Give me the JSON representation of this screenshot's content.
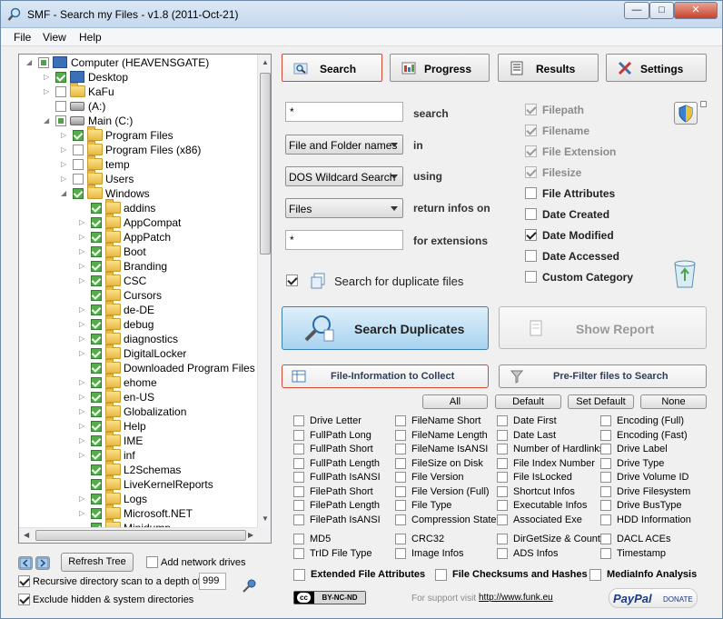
{
  "window": {
    "title": "SMF - Search my Files - v1.8 (2011-Oct-21)"
  },
  "menu": [
    "File",
    "View",
    "Help"
  ],
  "tree": {
    "rows": [
      {
        "label": "Computer (HEAVENSGATE)",
        "level": 0,
        "state": "part",
        "icon": "computer-icon",
        "arrow": "open"
      },
      {
        "label": "Desktop",
        "level": 1,
        "state": "on",
        "icon": "desktop-icon",
        "arrow": "closed"
      },
      {
        "label": "KaFu",
        "level": 1,
        "state": "off",
        "icon": "folder-icon",
        "arrow": "closed"
      },
      {
        "label": "(A:)",
        "level": 1,
        "state": "off",
        "icon": "floppy-drive-icon",
        "arrow": "none"
      },
      {
        "label": "Main (C:)",
        "level": 1,
        "state": "part",
        "icon": "drive-icon",
        "arrow": "open"
      },
      {
        "label": "Program Files",
        "level": 2,
        "state": "on",
        "icon": "folder-icon",
        "arrow": "closed"
      },
      {
        "label": "Program Files (x86)",
        "level": 2,
        "state": "off",
        "icon": "folder-icon",
        "arrow": "closed"
      },
      {
        "label": "temp",
        "level": 2,
        "state": "off",
        "icon": "folder-icon",
        "arrow": "closed"
      },
      {
        "label": "Users",
        "level": 2,
        "state": "off",
        "icon": "folder-icon",
        "arrow": "closed"
      },
      {
        "label": "Windows",
        "level": 2,
        "state": "on",
        "icon": "folder-icon",
        "arrow": "open"
      },
      {
        "label": "addins",
        "level": 3,
        "state": "on",
        "icon": "folder-icon",
        "arrow": "none"
      },
      {
        "label": "AppCompat",
        "level": 3,
        "state": "on",
        "icon": "folder-icon",
        "arrow": "closed"
      },
      {
        "label": "AppPatch",
        "level": 3,
        "state": "on",
        "icon": "folder-icon",
        "arrow": "closed"
      },
      {
        "label": "Boot",
        "level": 3,
        "state": "on",
        "icon": "folder-icon",
        "arrow": "closed"
      },
      {
        "label": "Branding",
        "level": 3,
        "state": "on",
        "icon": "folder-icon",
        "arrow": "closed"
      },
      {
        "label": "CSC",
        "level": 3,
        "state": "on",
        "icon": "folder-icon",
        "arrow": "closed"
      },
      {
        "label": "Cursors",
        "level": 3,
        "state": "on",
        "icon": "folder-icon",
        "arrow": "none"
      },
      {
        "label": "de-DE",
        "level": 3,
        "state": "on",
        "icon": "folder-icon",
        "arrow": "closed"
      },
      {
        "label": "debug",
        "level": 3,
        "state": "on",
        "icon": "folder-icon",
        "arrow": "closed"
      },
      {
        "label": "diagnostics",
        "level": 3,
        "state": "on",
        "icon": "folder-icon",
        "arrow": "closed"
      },
      {
        "label": "DigitalLocker",
        "level": 3,
        "state": "on",
        "icon": "folder-icon",
        "arrow": "closed"
      },
      {
        "label": "Downloaded Program Files",
        "level": 3,
        "state": "on",
        "icon": "folder-icon",
        "arrow": "none"
      },
      {
        "label": "ehome",
        "level": 3,
        "state": "on",
        "icon": "folder-icon",
        "arrow": "closed"
      },
      {
        "label": "en-US",
        "level": 3,
        "state": "on",
        "icon": "folder-icon",
        "arrow": "closed"
      },
      {
        "label": "Globalization",
        "level": 3,
        "state": "on",
        "icon": "folder-icon",
        "arrow": "closed"
      },
      {
        "label": "Help",
        "level": 3,
        "state": "on",
        "icon": "folder-icon",
        "arrow": "closed"
      },
      {
        "label": "IME",
        "level": 3,
        "state": "on",
        "icon": "folder-icon",
        "arrow": "closed"
      },
      {
        "label": "inf",
        "level": 3,
        "state": "on",
        "icon": "folder-icon",
        "arrow": "closed"
      },
      {
        "label": "L2Schemas",
        "level": 3,
        "state": "on",
        "icon": "folder-icon",
        "arrow": "none"
      },
      {
        "label": "LiveKernelReports",
        "level": 3,
        "state": "on",
        "icon": "folder-icon",
        "arrow": "none"
      },
      {
        "label": "Logs",
        "level": 3,
        "state": "on",
        "icon": "folder-icon",
        "arrow": "closed"
      },
      {
        "label": "Microsoft.NET",
        "level": 3,
        "state": "on",
        "icon": "folder-icon",
        "arrow": "closed"
      },
      {
        "label": "Minidump",
        "level": 3,
        "state": "on",
        "icon": "folder-icon",
        "arrow": "none"
      }
    ]
  },
  "bottom_left": {
    "refresh_label": "Refresh Tree",
    "add_network_label": "Add network drives",
    "recursive_label": "Recursive directory scan to a depth of",
    "depth_value": "999",
    "exclude_label": "Exclude hidden & system directories"
  },
  "tabs": [
    {
      "label": "Search",
      "icon": "search-icon",
      "active": true
    },
    {
      "label": "Progress",
      "icon": "progress-icon",
      "active": false
    },
    {
      "label": "Results",
      "icon": "results-icon",
      "active": false
    },
    {
      "label": "Settings",
      "icon": "settings-icon",
      "active": false
    }
  ],
  "search": {
    "pattern": "*",
    "pattern_label": "search",
    "in_value": "File and Folder names",
    "in_label": "in",
    "using_value": "DOS Wildcard Search",
    "using_label": "using",
    "return_value": "Files",
    "return_label": "return infos on",
    "ext_value": "*",
    "ext_label": "for extensions",
    "dup_label": "Search for duplicate files"
  },
  "attributes": [
    {
      "label": "Filepath",
      "checked": true,
      "disabled": true
    },
    {
      "label": "Filename",
      "checked": true,
      "disabled": true
    },
    {
      "label": "File Extension",
      "checked": true,
      "disabled": true
    },
    {
      "label": "Filesize",
      "checked": true,
      "disabled": true
    },
    {
      "label": "File Attributes",
      "checked": false,
      "disabled": false
    },
    {
      "label": "Date Created",
      "checked": false,
      "disabled": false
    },
    {
      "label": "Date Modified",
      "checked": true,
      "disabled": false
    },
    {
      "label": "Date Accessed",
      "checked": false,
      "disabled": false
    },
    {
      "label": "Custom Category",
      "checked": false,
      "disabled": false
    }
  ],
  "actions": {
    "search_dup": "Search Duplicates",
    "show_report": "Show Report",
    "file_info": "File-Information to Collect",
    "prefilter": "Pre-Filter files to Search"
  },
  "selectors": [
    "All",
    "Default",
    "Set Default",
    "None"
  ],
  "info_grid": [
    [
      "Drive Letter",
      "FileName Short",
      "Date First",
      "Encoding (Full)"
    ],
    [
      "FullPath Long",
      "FileName Length",
      "Date Last",
      "Encoding (Fast)"
    ],
    [
      "FullPath Short",
      "FileName IsANSI",
      "Number of Hardlinks",
      "Drive Label"
    ],
    [
      "FullPath Length",
      "FileSize on Disk",
      "File Index Number",
      "Drive Type"
    ],
    [
      "FullPath IsANSI",
      "File Version",
      "File IsLocked",
      "Drive Volume ID"
    ],
    [
      "FilePath Short",
      "File Version (Full)",
      "Shortcut Infos",
      "Drive Filesystem"
    ],
    [
      "FilePath Length",
      "File Type",
      "Executable Infos",
      "Drive BusType"
    ],
    [
      "FilePath IsANSI",
      "Compression State",
      "Associated Exe",
      "HDD Information"
    ]
  ],
  "info_grid2": [
    [
      "MD5",
      "CRC32",
      "DirGetSize & Count",
      "DACL ACEs"
    ],
    [
      "TrID File Type",
      "Image Infos",
      "ADS Infos",
      "Timestamp"
    ]
  ],
  "extended": [
    "Extended File Attributes",
    "File Checksums and Hashes",
    "MediaInfo Analysis"
  ],
  "footer": {
    "license": "BY-NC-ND",
    "support_text": "For support visit",
    "link": "http://www.funk.eu",
    "paypal": "PayPal",
    "donate": "DONATE"
  },
  "colors": {
    "accent_red": "#d24a34",
    "check_green": "#51b04a",
    "primary_blue": "#b9dcf3"
  }
}
